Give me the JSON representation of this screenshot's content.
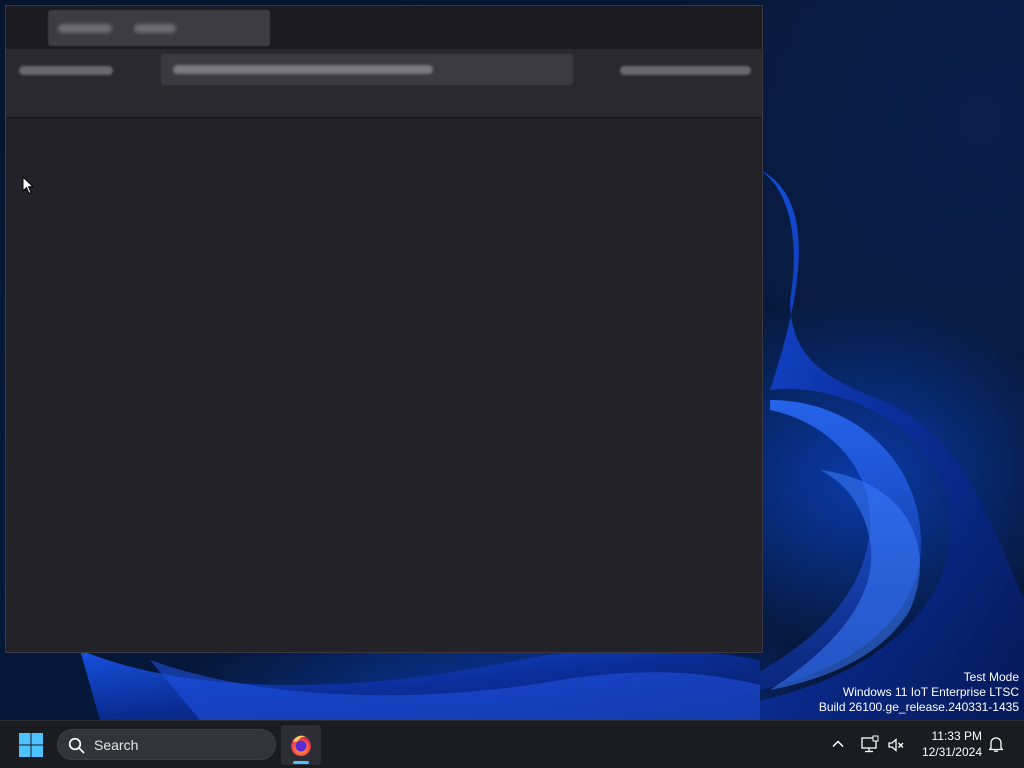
{
  "watermark": {
    "line1": "Test Mode",
    "line2": "Windows 11 IoT Enterprise LTSC",
    "line3": "Build 26100.ge_release.240331-1435"
  },
  "taskbar": {
    "start_icon": "windows-logo-icon",
    "search_placeholder": "Search",
    "pinned_apps": [
      {
        "name": "Firefox",
        "icon": "firefox-icon",
        "active": true
      }
    ],
    "tray": {
      "chevron_icon": "chevron-up-icon",
      "network_icon": "network-icon",
      "volume_icon": "volume-muted-icon",
      "time": "11:33 PM",
      "date": "12/31/2024",
      "notification_icon": "bell-icon"
    }
  },
  "colors": {
    "accent": "#4cc2ff",
    "window_bg": "#232229",
    "taskbar_bg": "#1b1c22"
  }
}
